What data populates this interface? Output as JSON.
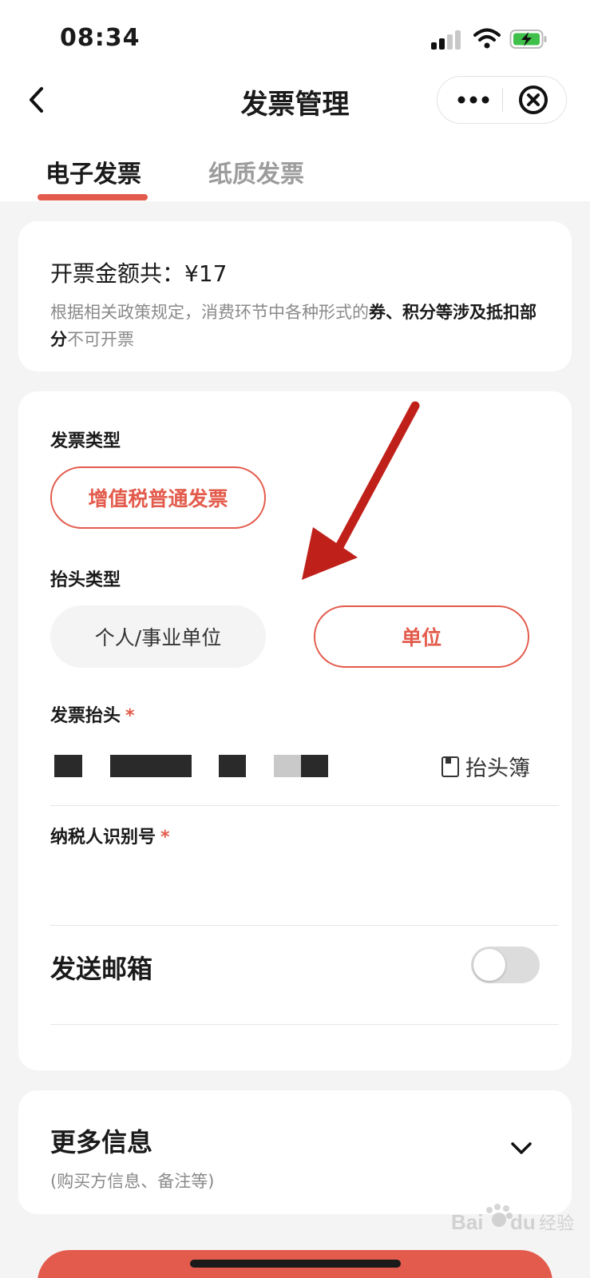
{
  "status_bar": {
    "time": "08:34"
  },
  "nav": {
    "title": "发票管理",
    "back_icon": "back-chevron-icon",
    "more_icon": "more-dots-icon",
    "close_icon": "close-circle-icon"
  },
  "tabs": [
    {
      "label": "电子发票",
      "active": true
    },
    {
      "label": "纸质发票",
      "active": false
    }
  ],
  "summary": {
    "amount_text": "开票金额共：¥17",
    "note_prefix": "根据相关政策规定，消费环节中各种形式的",
    "note_bold1": "券、积分等涉及抵扣部分",
    "note_suffix": "不可开票"
  },
  "invoice_type": {
    "label": "发票类型",
    "option": "增值税普通发票"
  },
  "header_type": {
    "label": "抬头类型",
    "options": [
      {
        "label": "个人/事业单位",
        "selected": false
      },
      {
        "label": "单位",
        "selected": true
      }
    ]
  },
  "invoice_header": {
    "label": "发票抬头",
    "required_mark": "*",
    "book_label": "抬头簿"
  },
  "tax_id": {
    "label": "纳税人识别号",
    "required_mark": "*"
  },
  "email": {
    "label": "发送邮箱",
    "enabled": false
  },
  "more_info": {
    "title": "更多信息",
    "subtitle": "(购买方信息、备注等)"
  },
  "colors": {
    "accent": "#e35b4c",
    "annotation_arrow": "#c0201a"
  }
}
